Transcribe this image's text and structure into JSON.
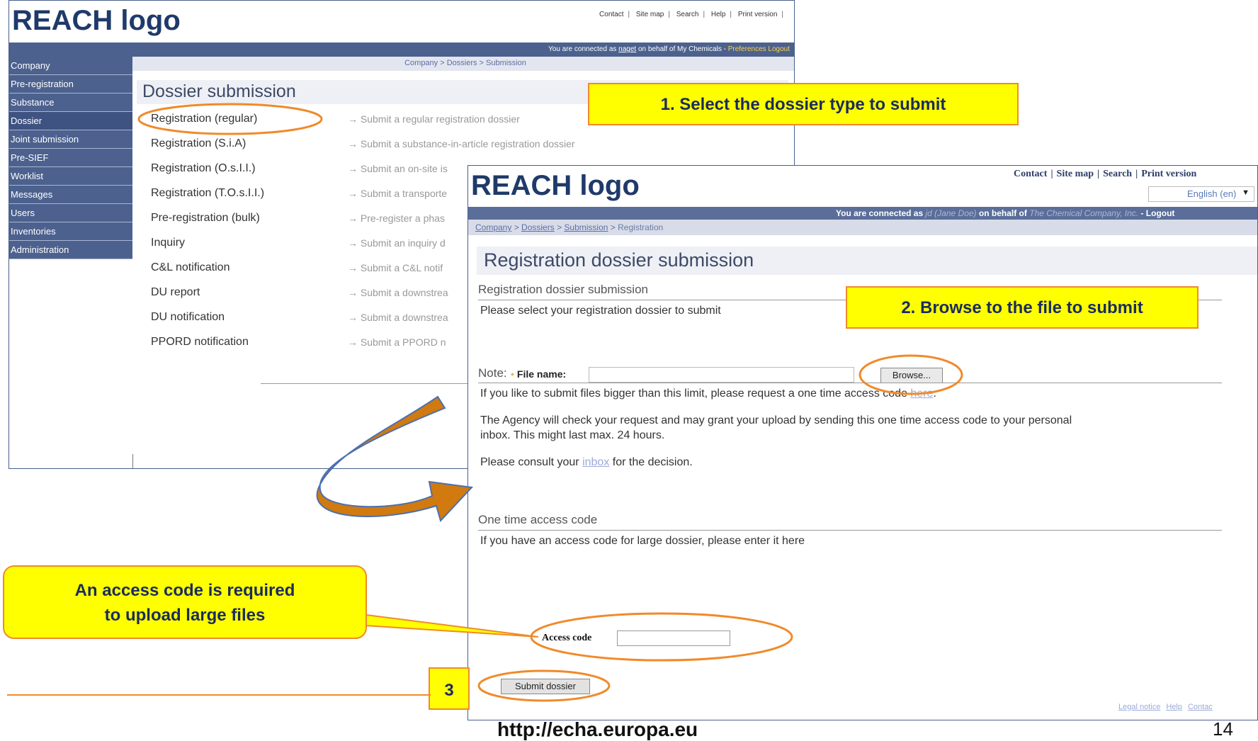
{
  "back_screen": {
    "logo": "REACH logo",
    "top_links": [
      "Contact",
      "Site map",
      "Search",
      "Help",
      "Print version"
    ],
    "banner": {
      "prefix": "You are connected as",
      "user": "naget",
      "middle": "on behalf of My Chemicals -",
      "links": "Preferences Logout"
    },
    "breadcrumb": "Company > Dossiers > Submission",
    "sidebar": [
      "Company",
      "Pre-registration",
      "Substance",
      "Dossier",
      "Joint submission",
      "Pre-SIEF",
      "Worklist",
      "Messages",
      "Users",
      "Inventories",
      "Administration"
    ],
    "title": "Dossier submission",
    "rows": [
      {
        "name": "Registration (regular)",
        "desc": "→ Submit a regular registration dossier"
      },
      {
        "name": "Registration (S.i.A)",
        "desc": "→ Submit a substance-in-article registration dossier"
      },
      {
        "name": "Registration (O.s.I.I.)",
        "desc": "→ Submit an on-site is"
      },
      {
        "name": "Registration (T.O.s.I.I.)",
        "desc": "→ Submit a transporte"
      },
      {
        "name": "Pre-registration (bulk)",
        "desc": "→ Pre-register a phas"
      },
      {
        "name": "Inquiry",
        "desc": "→ Submit an inquiry d"
      },
      {
        "name": "C&L notification",
        "desc": "→ Submit a C&L notif"
      },
      {
        "name": "DU report",
        "desc": "→ Submit a downstrea"
      },
      {
        "name": "DU notification",
        "desc": "→ Submit a downstrea"
      },
      {
        "name": "PPORD notification",
        "desc": "→ Submit a PPORD n"
      }
    ]
  },
  "front_screen": {
    "logo": "REACH logo",
    "top_links": [
      "Contact",
      "Site map",
      "Search",
      "Print version"
    ],
    "language": "English (en)",
    "banner": {
      "prefix": "You are connected as",
      "user": "jd (Jane Doe)",
      "middle": "on behalf of",
      "company": "The Chemical Company, Inc.",
      "tail": "- Logout"
    },
    "breadcrumb": {
      "links": [
        "Company",
        "Dossiers",
        "Submission"
      ],
      "current": "Registration",
      "sep": " > "
    },
    "title": "Registration dossier submission",
    "section1": "Registration dossier submission",
    "select_text": "Please select your registration dossier to submit",
    "file_label": "File name:",
    "browse_label": "Browse...",
    "note_title": "Note:",
    "note1_before": "If you like to submit files bigger than this limit, please request a one time access code ",
    "note1_link": "here",
    "note1_after": ".",
    "note2_line1": "The Agency will check your request and may grant your upload by sending this one time access code to your personal",
    "note2_line2": "inbox. This might last max. 24 hours.",
    "note3_before": "Please consult your ",
    "note3_link": "inbox",
    "note3_after": " for the decision.",
    "section2": "One time access code",
    "access_text": "If you have an access code for large dossier, please enter it here",
    "access_label": "Access code",
    "submit_label": "Submit dossier",
    "footer_links": [
      "Legal notice",
      "Help",
      "Contac"
    ]
  },
  "callouts": {
    "step1": "1. Select the dossier type to submit",
    "step2": "2. Browse to the file to submit",
    "access_line1": "An access code is required",
    "access_line2": "to upload large files",
    "step3": "3"
  },
  "slide": {
    "url": "http://echa.europa.eu",
    "page": "14"
  },
  "colors": {
    "callout_fill": "#ffff00",
    "callout_border": "#f08a2a",
    "nav": "#4c618e",
    "arrow": "#c97a10"
  }
}
